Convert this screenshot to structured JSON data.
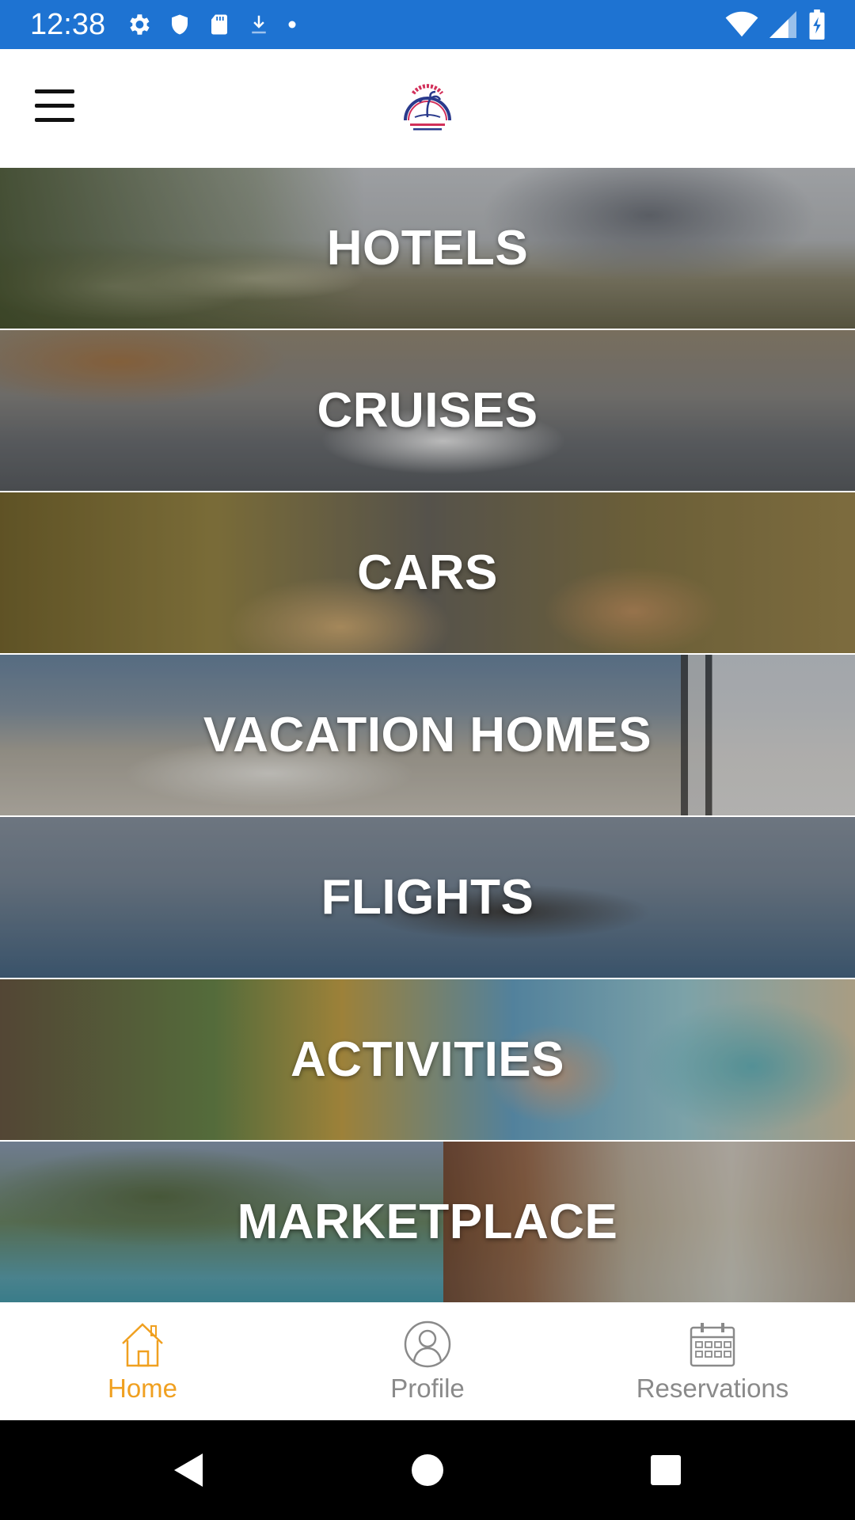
{
  "status_bar": {
    "time": "12:38",
    "left_icons": [
      "settings-icon",
      "shield-icon",
      "sd-card-icon",
      "download-icon",
      "dot-icon"
    ],
    "right_icons": [
      "wifi-icon",
      "signal-icon",
      "battery-charging-icon"
    ],
    "background_color": "#1e73d2"
  },
  "app_bar": {
    "menu_icon": "hamburger-menu-icon",
    "logo_icon": "travel-logo"
  },
  "categories": [
    {
      "label": "HOTELS"
    },
    {
      "label": "CRUISES"
    },
    {
      "label": "CARS"
    },
    {
      "label": "VACATION HOMES"
    },
    {
      "label": "FLIGHTS"
    },
    {
      "label": "ACTIVITIES"
    },
    {
      "label": "MARKETPLACE"
    }
  ],
  "bottom_nav": {
    "items": [
      {
        "label": "Home",
        "icon": "home-icon",
        "active": true
      },
      {
        "label": "Profile",
        "icon": "profile-icon",
        "active": false
      },
      {
        "label": "Reservations",
        "icon": "calendar-icon",
        "active": false
      }
    ],
    "active_color": "#f0a020",
    "inactive_color": "#8a8a8a"
  },
  "system_nav": {
    "buttons": [
      "back-icon",
      "home-circle-icon",
      "recents-icon"
    ]
  }
}
